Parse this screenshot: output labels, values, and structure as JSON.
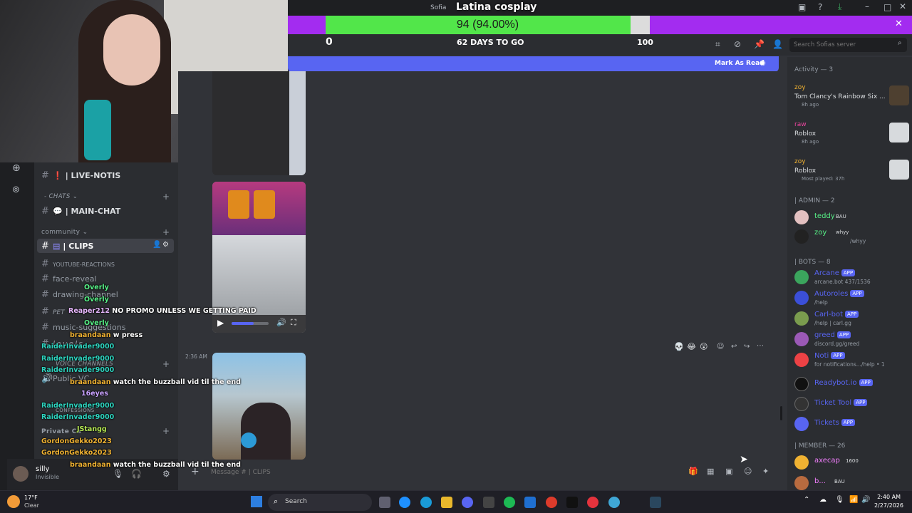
{
  "window": {
    "title": "Latina cosplay",
    "server_tab": "Sofia"
  },
  "goal": {
    "value_label": "94 (94.00%)",
    "progress": 0.94,
    "min": "0",
    "max": "100",
    "days_left": "62 DAYS TO GO"
  },
  "header": {
    "search_placeholder": "Search Sofias server"
  },
  "new_messages": {
    "mark_read": "Mark As Read"
  },
  "channels": {
    "items": [
      {
        "label": "| LIVE-NOTIS"
      },
      {
        "label": "- CHATS"
      },
      {
        "label": "| MAIN-CHAT"
      },
      {
        "label": "community"
      },
      {
        "label": "| CLIPS"
      },
      {
        "label": "YOUTUBE-REACTIONS"
      },
      {
        "label": "face-reveal"
      },
      {
        "label": "drawing-channel"
      },
      {
        "label": "PET"
      },
      {
        "label": "music-suggestions"
      },
      {
        "label": "levels"
      },
      {
        "label": "VOICE CHANNELS"
      },
      {
        "label": "Public VC"
      },
      {
        "label": "CONFESSIONS"
      },
      {
        "label": "Private Ca"
      }
    ]
  },
  "user_panel": {
    "name": "silly",
    "status": "Invisible"
  },
  "stream_chat": [
    {
      "user": "Overly",
      "text": ""
    },
    {
      "user": "Overly",
      "text": ""
    },
    {
      "user": "Reaper212",
      "text": "NO PROMO UNLESS WE GETTING PAID"
    },
    {
      "user": "Overly",
      "text": ""
    },
    {
      "user": "braandaan",
      "text": "w press"
    },
    {
      "user": "RaiderInvader9000",
      "text": ""
    },
    {
      "user": "RaiderInvader9000",
      "text": ""
    },
    {
      "user": "RaiderInvader9000",
      "text": ""
    },
    {
      "user": "braandaan",
      "text": "watch the buzzball vid til the end"
    },
    {
      "user": "16eyes",
      "text": ""
    },
    {
      "user": "RaiderInvader9000",
      "text": ""
    },
    {
      "user": "RaiderInvader9000",
      "text": ""
    },
    {
      "user": "JStangg",
      "text": ""
    },
    {
      "user": "GordonGekko2023",
      "text": ""
    },
    {
      "user": "GordonGekko2023",
      "text": ""
    },
    {
      "user": "braandaan",
      "text": "watch the buzzball vid til the end"
    }
  ],
  "messages": {
    "timestamp": "2:36 AM",
    "partial_text": "to",
    "input_placeholder": "Message # | CLIPS"
  },
  "activity": {
    "header": "Activity — 3",
    "items": [
      {
        "user": "zoy",
        "game": "Tom Clancy's Rainbow Six ...",
        "time": "8h ago"
      },
      {
        "user": "raw",
        "game": "Roblox",
        "time": "8h ago"
      },
      {
        "user": "zoy",
        "game": "Roblox",
        "time": "Most played: 37h"
      }
    ]
  },
  "members": {
    "admin_header": "| ADMIN — 2",
    "admins": [
      {
        "name": "teddy",
        "tag": "BAU",
        "status": "",
        "color": "#57f287"
      },
      {
        "name": "zoy",
        "tag": "whyy",
        "status": "/whyy",
        "color": "#57f287"
      }
    ],
    "bots_header": "| BOTS — 8",
    "bots": [
      {
        "name": "Arcane",
        "status": "arcane.bot 437/1536",
        "color": "#3ba55d"
      },
      {
        "name": "Autoroles",
        "status": "/help",
        "color": "#5865f2"
      },
      {
        "name": "Carl-bot",
        "status": "/help | carl.gg",
        "color": "#57a05f"
      },
      {
        "name": "greed",
        "status": "discord.gg/greed",
        "color": "#9b59b6"
      },
      {
        "name": "Noti",
        "status": "for notifications.../help • 1",
        "color": "#ed4245"
      },
      {
        "name": "Readybot.io",
        "status": "",
        "color": "#111"
      },
      {
        "name": "Ticket Tool",
        "status": "",
        "color": "#333"
      },
      {
        "name": "Tickets",
        "status": "",
        "color": "#5865f2"
      }
    ],
    "app_badge": "APP",
    "member_header": "| MEMBER — 26",
    "members": [
      {
        "name": "axecap",
        "status": "",
        "tag": "1600",
        "color": "#f47fff"
      },
      {
        "name": "b...",
        "status": "",
        "tag": "BAU",
        "color": "#f47fff"
      }
    ]
  },
  "taskbar": {
    "weather_temp": "17°F",
    "weather_desc": "Clear",
    "search_label": "Search",
    "time": "2:40 AM",
    "date": "2/27/2026"
  },
  "colors": {
    "accent": "#5865f2",
    "goal_fill": "#52e64a",
    "goal_bg": "#a32cf0"
  }
}
